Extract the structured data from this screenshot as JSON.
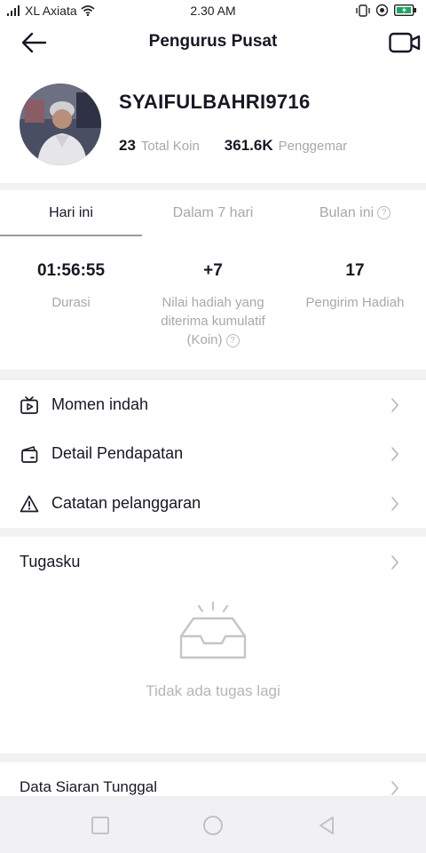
{
  "status_bar": {
    "carrier": "XL Axiata",
    "time": "2.30 AM"
  },
  "header": {
    "title": "Pengurus Pusat",
    "back_icon": "arrow-left-icon",
    "action_icon": "video-camera-icon"
  },
  "profile": {
    "username": "SYAIFULBAHRI9716",
    "coins_value": "23",
    "coins_label": "Total Koin",
    "fans_value": "361.6K",
    "fans_label": "Penggemar"
  },
  "tabs": [
    {
      "label": "Hari ini",
      "active": true
    },
    {
      "label": "Dalam 7 hari",
      "active": false
    },
    {
      "label": "Bulan ini",
      "active": false
    }
  ],
  "metrics": [
    {
      "value": "01:56:55",
      "label": "Durasi"
    },
    {
      "value": "+7",
      "label": "Nilai hadiah yang diterima kumulatif (Koin)"
    },
    {
      "value": "17",
      "label": "Pengirim Hadiah"
    }
  ],
  "menu": [
    {
      "label": "Momen indah",
      "icon": "tv-play-icon"
    },
    {
      "label": "Detail Pendapatan",
      "icon": "wallet-icon"
    },
    {
      "label": "Catatan pelanggaran",
      "icon": "warning-icon"
    }
  ],
  "tasks": {
    "title": "Tugasku",
    "empty_text": "Tidak ada tugas lagi",
    "empty_icon": "empty-inbox-icon"
  },
  "data_section": {
    "title": "Data Siaran Tunggal"
  },
  "colors": {
    "text": "#161823",
    "muted": "#a7a8ad",
    "background": "#f2f2f5"
  }
}
